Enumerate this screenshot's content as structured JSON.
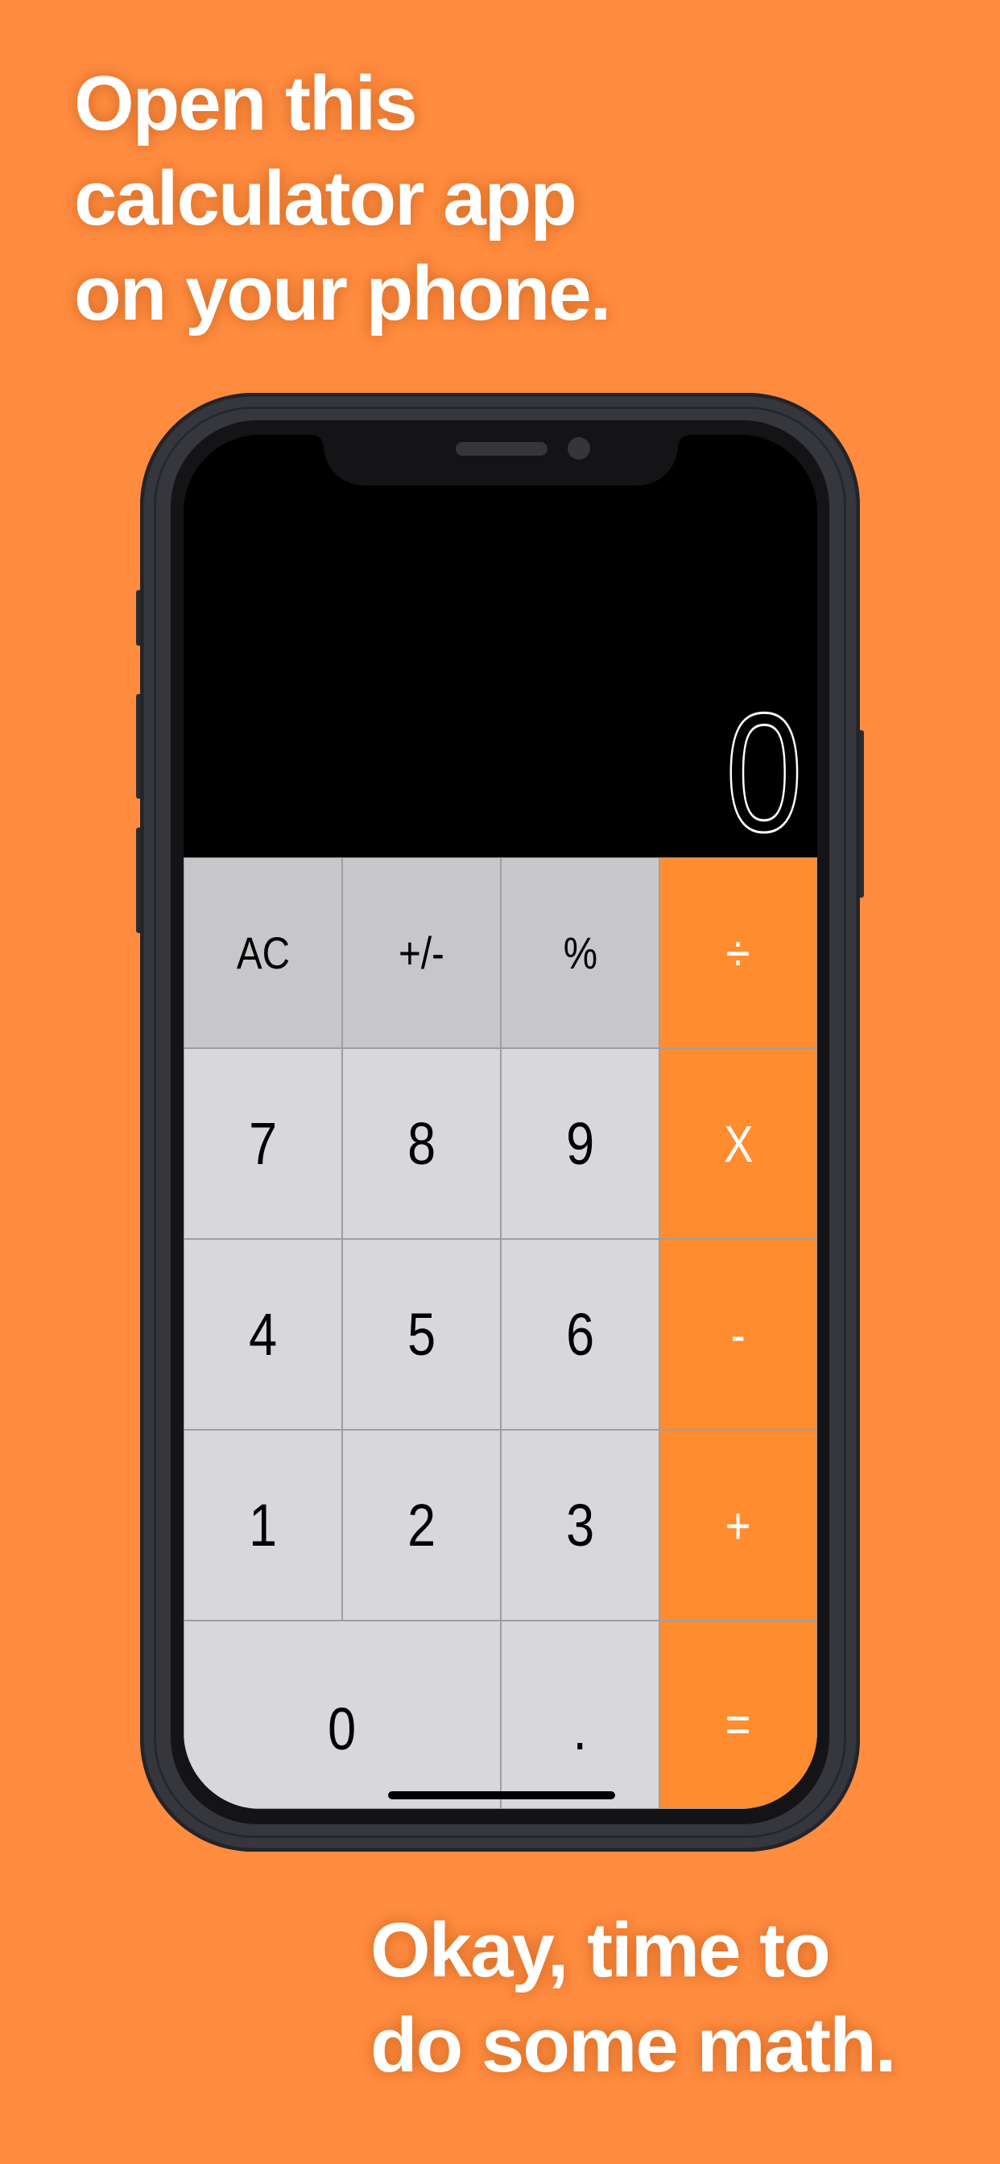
{
  "captions": {
    "top": [
      "Open this",
      "calculator app",
      "on your phone."
    ],
    "bottom": [
      "Okay, time to",
      "do some math."
    ]
  },
  "colors": {
    "background": "#ff8c3f",
    "operator_key": "#ff8d2f",
    "function_key": "#c7c7cb",
    "number_key": "#d8d8dc",
    "display_bg": "#000000",
    "display_text": "#ffffff"
  },
  "calculator": {
    "display_value": "0",
    "keys": {
      "clear": "AC",
      "sign": "+/-",
      "percent": "%",
      "divide": "÷",
      "seven": "7",
      "eight": "8",
      "nine": "9",
      "multiply": "X",
      "four": "4",
      "five": "5",
      "six": "6",
      "subtract": "-",
      "one": "1",
      "two": "2",
      "three": "3",
      "add": "+",
      "zero": "0",
      "decimal": ".",
      "equals": "="
    }
  }
}
